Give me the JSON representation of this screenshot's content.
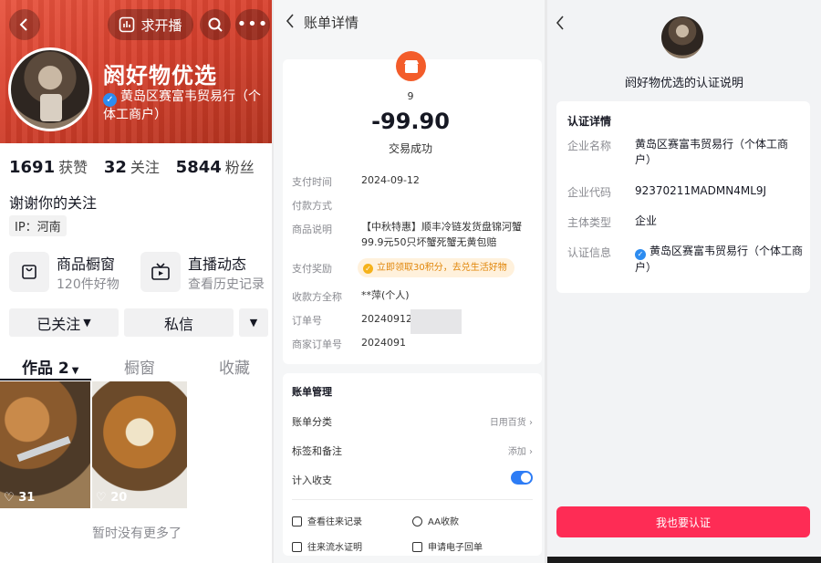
{
  "profile": {
    "top_live_label": "求开播",
    "nickname": "阏好物优选",
    "verified_name": "黄岛区赛富韦贸易行（个体工商户）",
    "stats": [
      {
        "value": "1691",
        "label": "获赞"
      },
      {
        "value": "32",
        "label": "关注"
      },
      {
        "value": "5844",
        "label": "粉丝"
      }
    ],
    "bio": "谢谢你的关注",
    "ip": "IP：河南",
    "shop_window": {
      "title": "商品橱窗",
      "sub": "120件好物"
    },
    "live_feed": {
      "title": "直播动态",
      "sub": "查看历史记录"
    },
    "followed_label": "已关注",
    "message_label": "私信",
    "tabs": [
      "作品 2",
      "橱窗",
      "收藏"
    ],
    "videos": [
      {
        "likes": "31"
      },
      {
        "likes": "20"
      }
    ],
    "no_more": "暂时没有更多了"
  },
  "bill": {
    "header": "账单详情",
    "merchant_mark": "9",
    "amount": "-99.90",
    "status": "交易成功",
    "rows": [
      {
        "label": "支付时间",
        "value": "2024-09-12"
      },
      {
        "label": "付款方式",
        "value": ""
      },
      {
        "label": "商品说明",
        "value": "【中秋特惠】顺丰冷链发货盘锦河蟹99.9元50只坏蟹死蟹无黄包赔"
      },
      {
        "label": "支付奖励",
        "value": ""
      },
      {
        "label": "收款方全称",
        "value": "**萍(个人)"
      },
      {
        "label": "订单号",
        "value": "202409122"
      },
      {
        "label": "商家订单号",
        "value": "2024091"
      }
    ],
    "reward_text": "立即领取30积分，去兑生活好物",
    "management": {
      "title": "账单管理",
      "category_label": "账单分类",
      "category_value": "日用百货",
      "tag_label": "标签和备注",
      "tag_value": "添加",
      "count_label": "计入收支"
    },
    "links": [
      "查看往来记录",
      "AA收款",
      "往来流水证明",
      "申请电子回单"
    ]
  },
  "cert": {
    "title": "阏好物优选的认证说明",
    "section": "认证详情",
    "fields": [
      {
        "label": "企业名称",
        "value": "黄岛区赛富韦贸易行（个体工商户）"
      },
      {
        "label": "企业代码",
        "value": "92370211MADMN4ML9J"
      },
      {
        "label": "主体类型",
        "value": "企业"
      },
      {
        "label": "认证信息",
        "value": "黄岛区赛富韦贸易行（个体工商户）"
      }
    ],
    "cta": "我也要认证"
  },
  "colors": {
    "brand_red": "#fe2c55",
    "hero": "#d6402d",
    "accent_blue": "#2d7cf5",
    "reward_orange": "#e0860a"
  }
}
